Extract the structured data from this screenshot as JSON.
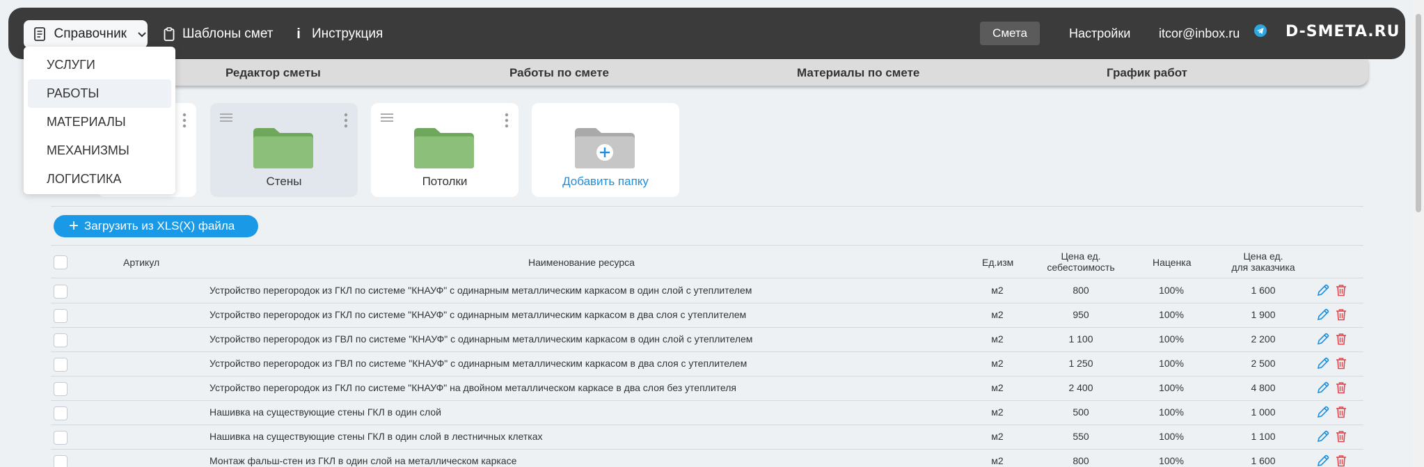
{
  "topbar": {
    "reference_label": "Справочник",
    "templates_label": "Шаблоны смет",
    "instruction_icon": "i",
    "instruction_label": "Инструкция",
    "smeta_label": "Смета",
    "settings_label": "Настройки",
    "email": "itcor@inbox.ru",
    "logo": "D-SMETA.RU"
  },
  "menu": {
    "items": [
      {
        "label": "УСЛУГИ"
      },
      {
        "label": "РАБОТЫ"
      },
      {
        "label": "МАТЕРИАЛЫ"
      },
      {
        "label": "МЕХАНИЗМЫ"
      },
      {
        "label": "ЛОГИСТИКА"
      }
    ]
  },
  "tabs": [
    {
      "label": "Редактор сметы"
    },
    {
      "label": "Работы по смете"
    },
    {
      "label": "Материалы по смете"
    },
    {
      "label": "График работ"
    }
  ],
  "folders": [
    {
      "label": "Стены"
    },
    {
      "label": "Потолки"
    },
    {
      "label": "Добавить папку"
    }
  ],
  "upload_label": "Загрузить из XLS(X) файла",
  "table": {
    "headers": {
      "article": "Артикул",
      "name": "Наименование ресурса",
      "unit": "Ед.изм",
      "cost_line1": "Цена ед.",
      "cost_line2": "себестоимость",
      "markup": "Наценка",
      "price_line1": "Цена ед.",
      "price_line2": "для заказчика"
    },
    "rows": [
      {
        "name": "Устройство перегородок из ГКЛ по системе \"КНАУФ\" с одинарным металлическим каркасом в один слой с утеплителем",
        "unit": "м2",
        "cost": "800",
        "markup": "100%",
        "price": "1 600"
      },
      {
        "name": "Устройство перегородок из ГКЛ по системе \"КНАУФ\" с одинарным металлическим каркасом в два слоя с утеплителем",
        "unit": "м2",
        "cost": "950",
        "markup": "100%",
        "price": "1 900"
      },
      {
        "name": "Устройство перегородок из ГВЛ по системе \"КНАУФ\" с одинарным металлическим каркасом в один слой с утеплителем",
        "unit": "м2",
        "cost": "1 100",
        "markup": "100%",
        "price": "2 200"
      },
      {
        "name": "Устройство перегородок из ГВЛ по системе \"КНАУФ\" с одинарным металлическим каркасом в два слоя с утеплителем",
        "unit": "м2",
        "cost": "1 250",
        "markup": "100%",
        "price": "2 500"
      },
      {
        "name": "Устройство перегородок из ГКЛ по системе \"КНАУФ\" на двойном металлическом каркасе в два слоя без утеплителя",
        "unit": "м2",
        "cost": "2 400",
        "markup": "100%",
        "price": "4 800"
      },
      {
        "name": "Нашивка на существующие стены ГКЛ в один слой",
        "unit": "м2",
        "cost": "500",
        "markup": "100%",
        "price": "1 000"
      },
      {
        "name": "Нашивка на существующие стены ГКЛ в один слой в лестничных клетках",
        "unit": "м2",
        "cost": "550",
        "markup": "100%",
        "price": "1 100"
      },
      {
        "name": "Монтаж фальш-стен из ГКЛ в один слой на металлическом каркасе",
        "unit": "м2",
        "cost": "800",
        "markup": "100%",
        "price": "1 600"
      }
    ]
  },
  "colors": {
    "topbar": "#3b3b3b",
    "accent": "#1a9ae6",
    "folder_green": "#8bbf7a",
    "delete_red": "#e0474c"
  }
}
